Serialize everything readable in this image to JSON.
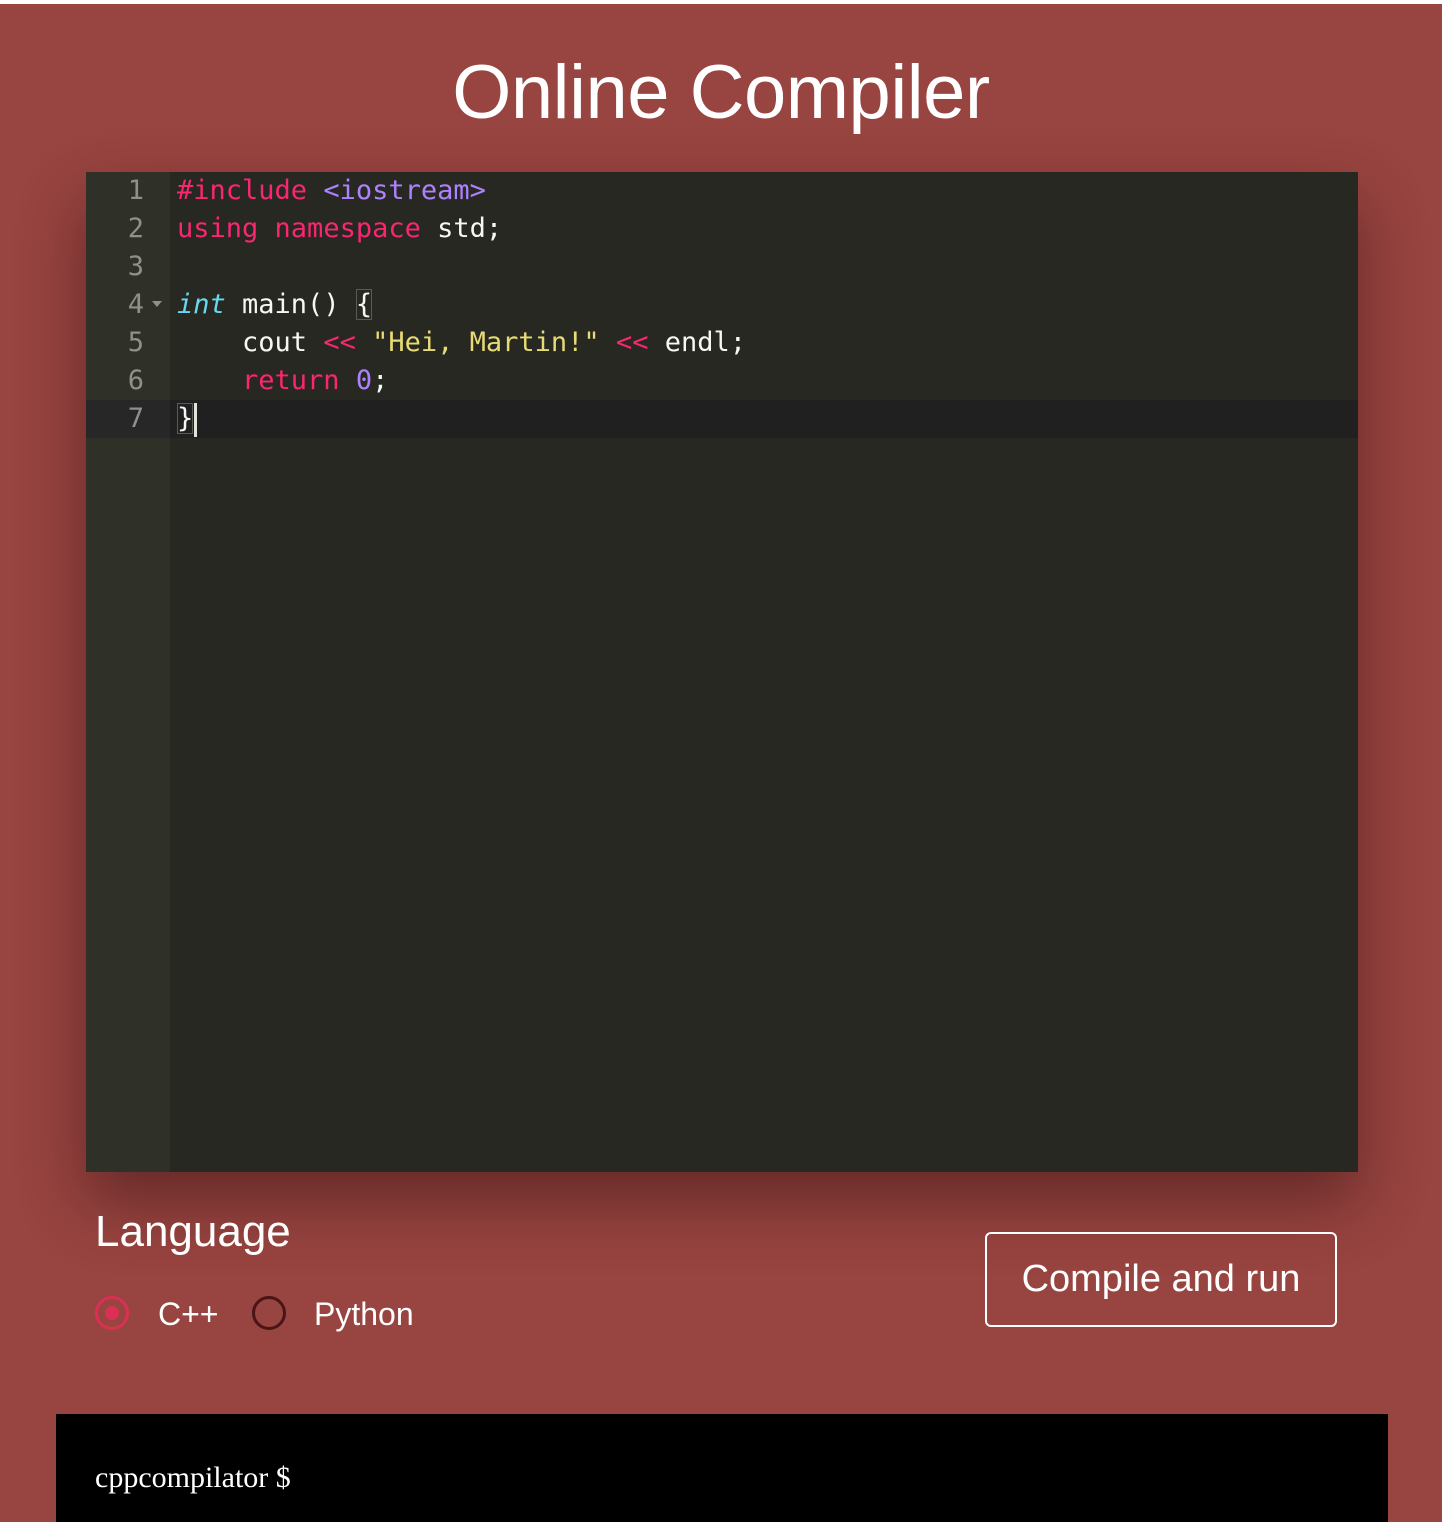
{
  "header": {
    "title": "Online Compiler"
  },
  "editor": {
    "lines": [
      {
        "number": "1",
        "tokens": [
          {
            "type": "pre",
            "text": "#include "
          },
          {
            "type": "inc",
            "text": "<iostream>"
          }
        ]
      },
      {
        "number": "2",
        "tokens": [
          {
            "type": "kw",
            "text": "using"
          },
          {
            "type": "plain",
            "text": " "
          },
          {
            "type": "kw",
            "text": "namespace"
          },
          {
            "type": "plain",
            "text": " std;"
          }
        ]
      },
      {
        "number": "3",
        "tokens": []
      },
      {
        "number": "4",
        "fold": true,
        "tokens": [
          {
            "type": "type",
            "text": "int"
          },
          {
            "type": "plain",
            "text": " main() "
          },
          {
            "type": "plain",
            "text": "{",
            "box": true
          }
        ]
      },
      {
        "number": "5",
        "tokens": [
          {
            "type": "plain",
            "text": "    cout "
          },
          {
            "type": "op",
            "text": "<<"
          },
          {
            "type": "plain",
            "text": " "
          },
          {
            "type": "str",
            "text": "\"Hei, Martin!\""
          },
          {
            "type": "plain",
            "text": " "
          },
          {
            "type": "op",
            "text": "<<"
          },
          {
            "type": "plain",
            "text": " endl;"
          }
        ]
      },
      {
        "number": "6",
        "tokens": [
          {
            "type": "plain",
            "text": "    "
          },
          {
            "type": "kw",
            "text": "return"
          },
          {
            "type": "plain",
            "text": " "
          },
          {
            "type": "num",
            "text": "0"
          },
          {
            "type": "plain",
            "text": ";"
          }
        ]
      },
      {
        "number": "7",
        "active": true,
        "cursor": true,
        "tokens": [
          {
            "type": "plain",
            "text": "}",
            "box": true
          }
        ]
      }
    ]
  },
  "language": {
    "heading": "Language",
    "options": [
      {
        "label": "C++",
        "checked": true
      },
      {
        "label": "Python",
        "checked": false
      }
    ]
  },
  "actions": {
    "compile_label": "Compile and run"
  },
  "terminal": {
    "prompt": "cppcompilator $"
  },
  "colors": {
    "page_background": "#984440",
    "editor_background": "#272822",
    "gutter_background": "#2f3129",
    "radio_accent": "#dc2f55",
    "terminal_background": "#000000"
  }
}
